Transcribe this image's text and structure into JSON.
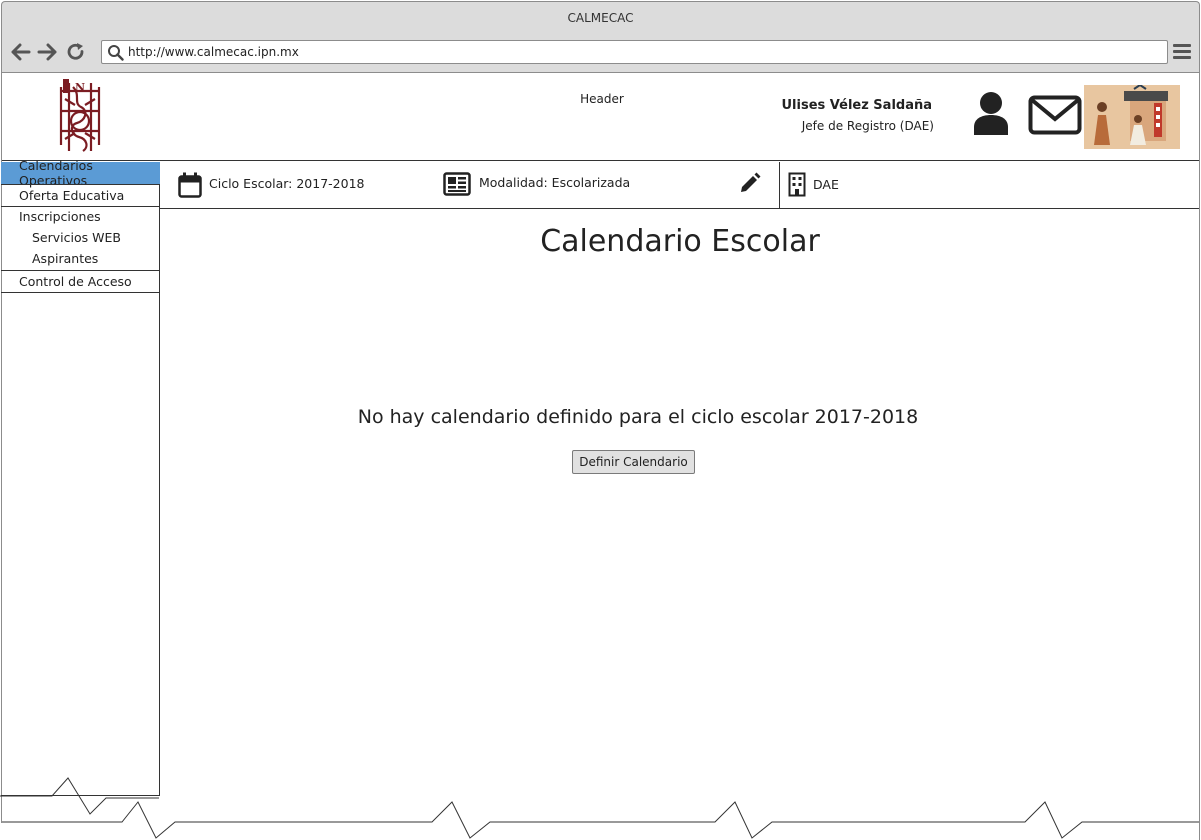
{
  "window": {
    "title": "CALMECAC",
    "url": "http://www.calmecac.ipn.mx"
  },
  "header": {
    "label": "Header",
    "user_name": "Ulises Vélez Saldaña",
    "user_role": "Jefe de Registro (DAE)"
  },
  "sidebar": {
    "items": [
      {
        "label": "Calendarios Operativos",
        "active": true
      },
      {
        "label": "Oferta Educativa",
        "active": false
      },
      {
        "label": "Inscripciones",
        "active": false
      },
      {
        "label": "Servicios WEB",
        "active": false,
        "sub": true
      },
      {
        "label": "Aspirantes",
        "active": false,
        "sub": true
      },
      {
        "label": "Control de Acceso",
        "active": false
      }
    ]
  },
  "infobar": {
    "ciclo": "Ciclo Escolar: 2017-2018",
    "modalidad": "Modalidad: Escolarizada",
    "dependencia": "DAE"
  },
  "main": {
    "title": "Calendario Escolar",
    "empty_message": "No hay calendario definido para el ciclo escolar 2017-2018",
    "define_button": "Definir Calendario"
  },
  "colors": {
    "active_item": "#5b9bd5",
    "chrome": "#dcdcdc",
    "logo": "#7b1c22"
  }
}
